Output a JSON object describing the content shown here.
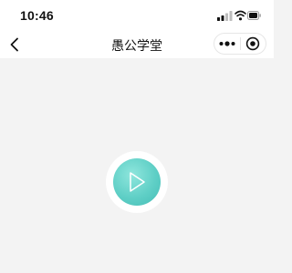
{
  "status_bar": {
    "time": "10:46",
    "icons": [
      "signal-icon",
      "wifi-icon",
      "battery-icon"
    ]
  },
  "nav": {
    "title": "愚公学堂",
    "back_icon": "chevron-left-icon",
    "capsule": {
      "more_icon": "more-dots-icon",
      "close_icon": "target-close-icon"
    }
  },
  "content": {
    "play_icon": "play-icon",
    "accent_color": "#5fcfc6",
    "background_color": "#f3f3f3"
  }
}
